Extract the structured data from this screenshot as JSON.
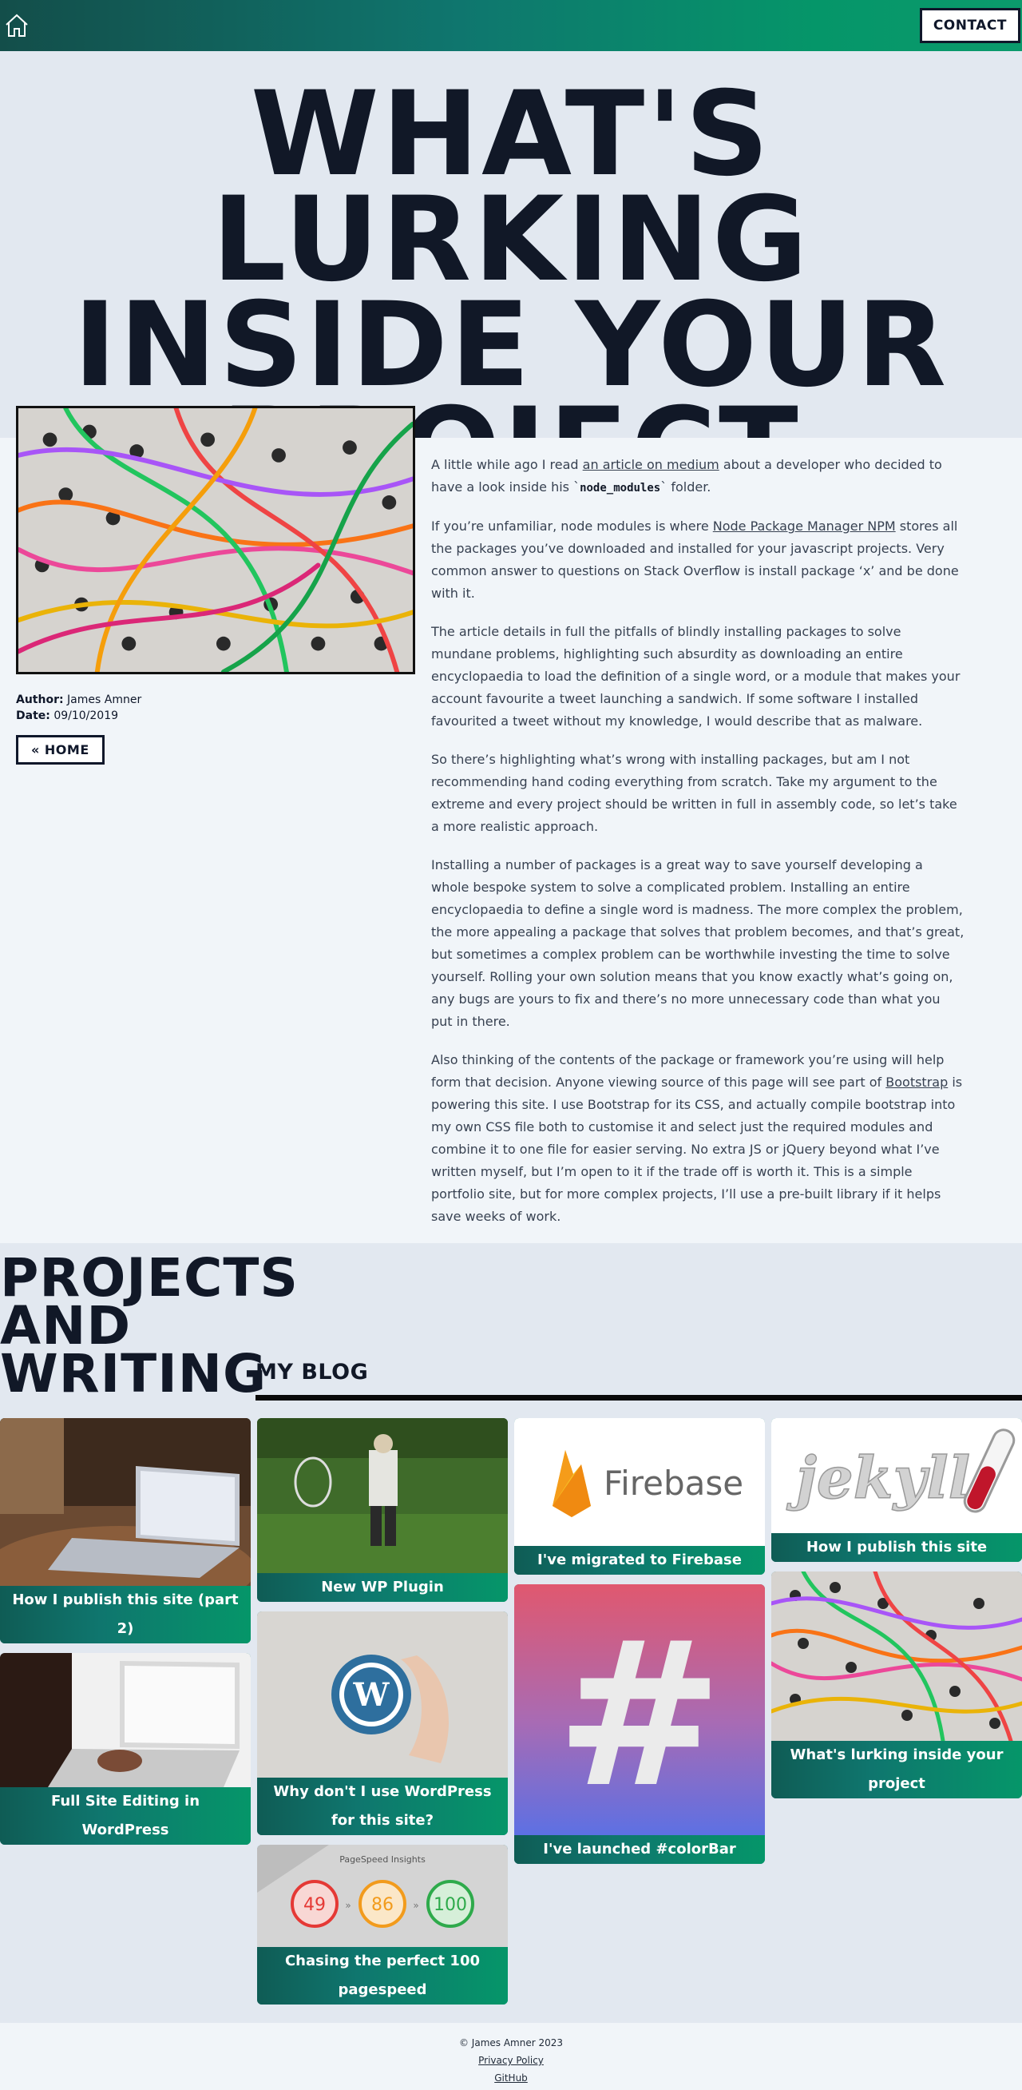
{
  "nav": {
    "home_icon": "home-icon",
    "contact_label": "CONTACT"
  },
  "hero": {
    "title": "WHAT'S LURKING INSIDE YOUR PROJECT"
  },
  "article": {
    "author_label": "Author:",
    "author": "James Amner",
    "date_label": "Date:",
    "date": "09/10/2019",
    "home_button": "« HOME",
    "p1_a": "A little while ago I read ",
    "p1_link": "an article on medium",
    "p1_b": " about a developer who decided to have a look inside his `",
    "p1_code": "node_modules",
    "p1_c": "` folder.",
    "p2_a": "If you’re unfamiliar, node modules is where ",
    "p2_link": "Node Package Manager NPM",
    "p2_b": " stores all the packages you’ve downloaded and installed for your javascript projects. Very common answer to questions on Stack Overflow is install package ‘x’ and be done with it.",
    "p3": "The article details in full the pitfalls of blindly installing packages to solve mundane problems, highlighting such absurdity as downloading an entire encyclopaedia to load the definition of a single word, or a module that makes your account favourite a tweet launching a sandwich. If some software I installed favourited a tweet without my knowledge, I would describe that as malware.",
    "p4": "So there’s highlighting what’s wrong with installing packages, but am I not recommending hand coding everything from scratch. Take my argument to the extreme and every project should be written in full in assembly code, so let’s take a more realistic approach.",
    "p5": "Installing a number of packages is a great way to save yourself developing a whole bespoke system to solve a complicated problem. Installing an entire encyclopaedia to define a single word is madness. The more complex the problem, the more appealing a package that solves that problem becomes, and that’s great, but sometimes a complex problem can be worthwhile investing the time to solve yourself. Rolling your own solution means that you know exactly what’s going on, any bugs are yours to fix and there’s no more unnecessary code than what you put in there.",
    "p6_a": "Also thinking of the contents of the package or framework you’re using will help form that decision. Anyone viewing source of this page will see part of ",
    "p6_link": "Bootstrap",
    "p6_b": " is powering this site. I use Bootstrap for its CSS, and actually compile bootstrap into my own CSS file both to customise it and select just the required modules and combine it to one file for easier serving. No extra JS or jQuery beyond what I’ve written myself, but I’m open to it if the trade off is worth it. This is a simple portfolio site, but for more complex projects, I’ll use a pre-built library if it helps save weeks of work."
  },
  "projects": {
    "title_line1": "PROJECTS",
    "title_line2": "AND",
    "title_line3": "WRITING",
    "blog_heading": "MY BLOG",
    "cards": {
      "c1": "How I publish this site (part 2)",
      "c2": "Full Site Editing in WordPress",
      "c3": "New WP Plugin",
      "c4": "Why don't I use WordPress for this site?",
      "c5": "Chasing the perfect 100 pagespeed",
      "c6": "I've migrated to Firebase",
      "c7": "I've launched #colorBar",
      "c8": "How I publish this site",
      "c9": "What's lurking inside your project"
    },
    "firebase_logo_text": "Firebase",
    "jekyll_logo_text": "jekyll",
    "hash_glyph": "#",
    "pagespeed": {
      "label": "PageSpeed Insights",
      "s1": "49",
      "s2": "86",
      "s3": "100"
    }
  },
  "footer": {
    "copyright": "© James Amner 2023",
    "privacy": "Privacy Policy",
    "github": "GitHub"
  }
}
